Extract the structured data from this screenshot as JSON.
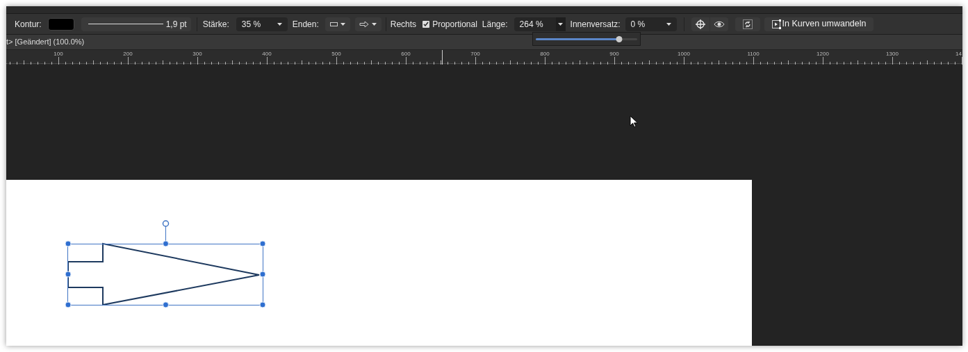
{
  "toolbar": {
    "stroke_label": "Kontur:",
    "line_weight": "1,9 pt",
    "strength_label": "Stärke:",
    "strength_value": "35 %",
    "ends_label": "Enden:",
    "side_label": "Rechts",
    "proportional": {
      "label": "Proportional",
      "checked": true
    },
    "length_label": "Länge:",
    "length_value": "264 %",
    "length_slider": {
      "level": 0.82
    },
    "inset_label": "Innenversatz:",
    "inset_value": "0 %",
    "convert_button": "In Kurven umwandeln"
  },
  "document_tab": {
    "title": "t> [Geändert] (100.0%)"
  },
  "ruler": {
    "labels": [
      "100",
      "200",
      "300",
      "400",
      "500",
      "600",
      "700",
      "800",
      "900",
      "1000",
      "1100",
      "1200",
      "1300",
      "14"
    ]
  }
}
